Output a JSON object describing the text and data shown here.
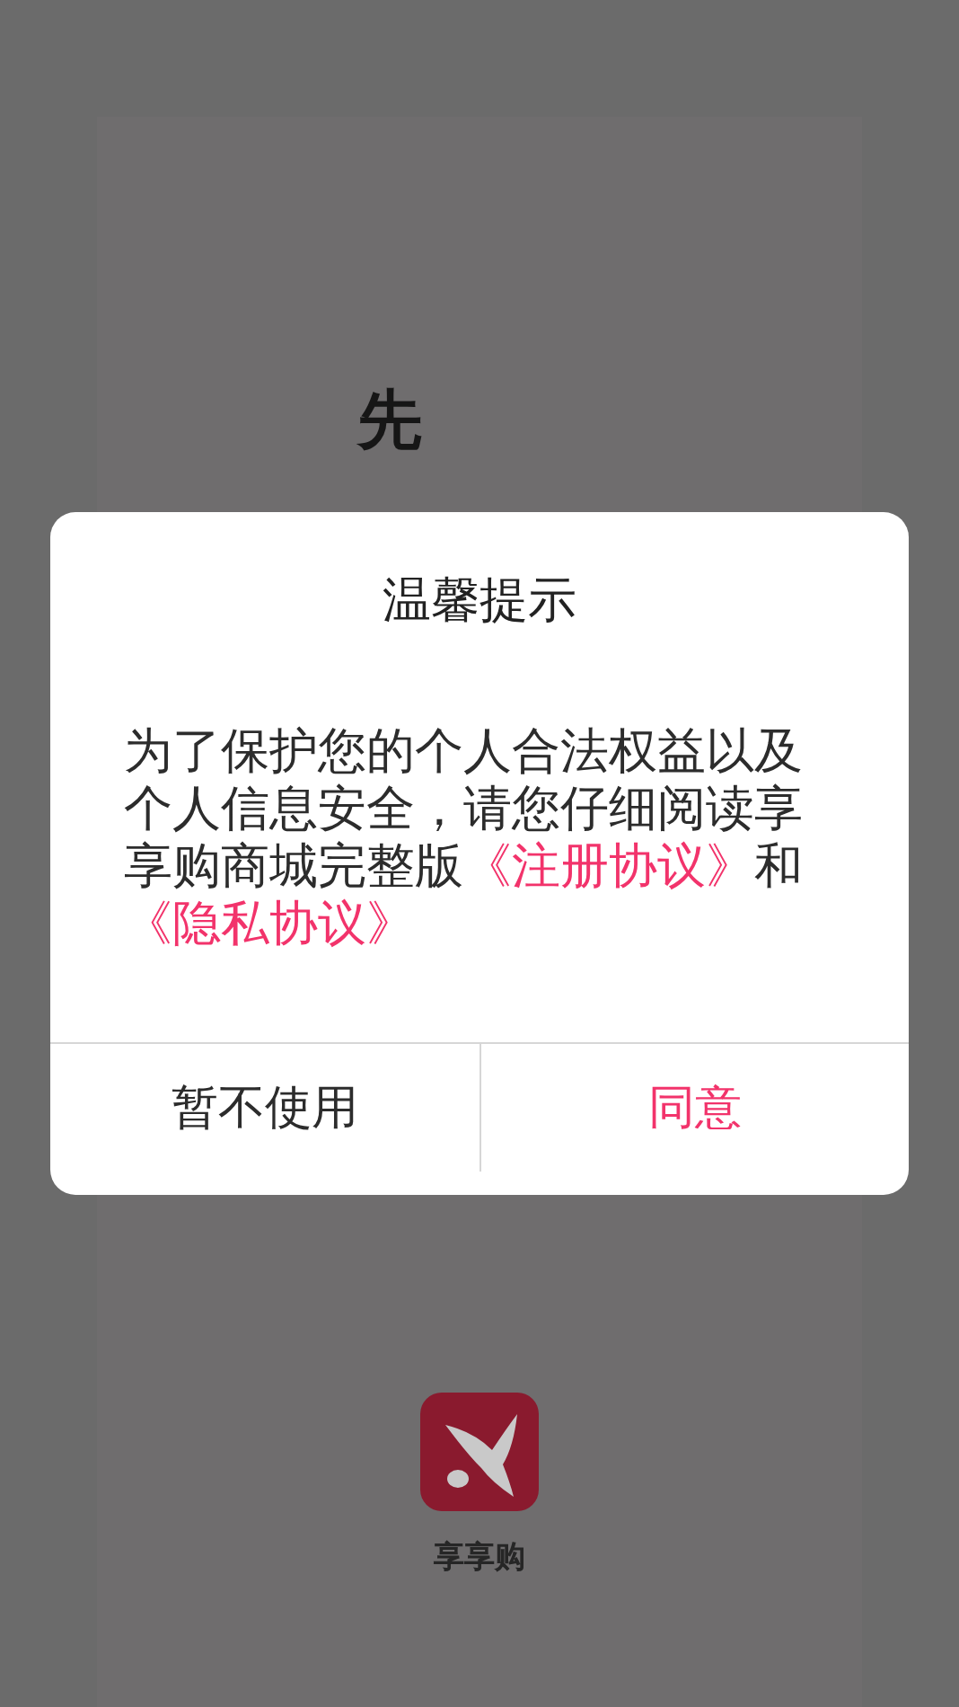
{
  "background": {
    "vertical_text": "先",
    "app_name": "享享购"
  },
  "dialog": {
    "title": "温馨提示",
    "message": [
      {
        "kind": "text",
        "text": "为了保护您的个人合法权益以及个人信息安全，请您仔细阅读享享购商城完整版"
      },
      {
        "kind": "link",
        "text": "《注册协议》"
      },
      {
        "kind": "text",
        "text": "和"
      },
      {
        "kind": "link",
        "text": "《隐私协议》"
      }
    ],
    "buttons": [
      {
        "label": "暂不使用",
        "kind": "secondary"
      },
      {
        "label": "同意",
        "kind": "primary"
      }
    ]
  }
}
